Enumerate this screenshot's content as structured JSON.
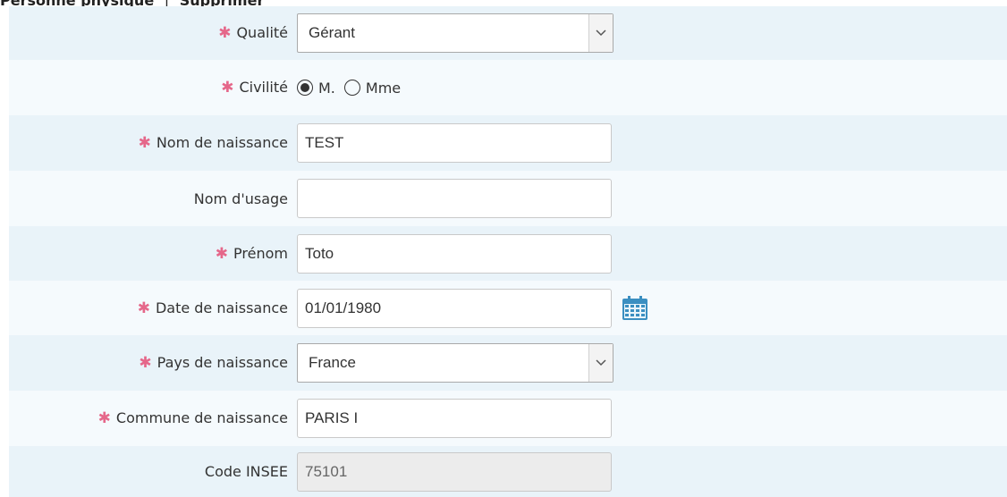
{
  "header": {
    "title": "Personne physique",
    "separator": "|",
    "link": "Supprimer"
  },
  "form": {
    "qualite": {
      "label": "Qualité",
      "value": "Gérant"
    },
    "civilite": {
      "label": "Civilité",
      "options": [
        "M.",
        "Mme"
      ],
      "selected": "M."
    },
    "nom_naissance": {
      "label": "Nom de naissance",
      "value": "TEST"
    },
    "nom_usage": {
      "label": "Nom d'usage",
      "value": ""
    },
    "prenom": {
      "label": "Prénom",
      "value": "Toto"
    },
    "date_naissance": {
      "label": "Date de naissance",
      "value": "01/01/1980"
    },
    "pays_naissance": {
      "label": "Pays de naissance",
      "value": "France"
    },
    "commune_naissance": {
      "label": "Commune de naissance",
      "value": "PARIS I"
    },
    "code_insee": {
      "label": "Code INSEE",
      "value": "75101"
    }
  },
  "colors": {
    "required": "#e5678a",
    "row_alt": "#e9f3f9",
    "row_plain": "#f5fafd",
    "icon": "#3b8fc1"
  },
  "icons": {
    "required": "asterisk-icon",
    "calendar": "calendar-icon",
    "dropdown": "chevron-down-icon"
  }
}
